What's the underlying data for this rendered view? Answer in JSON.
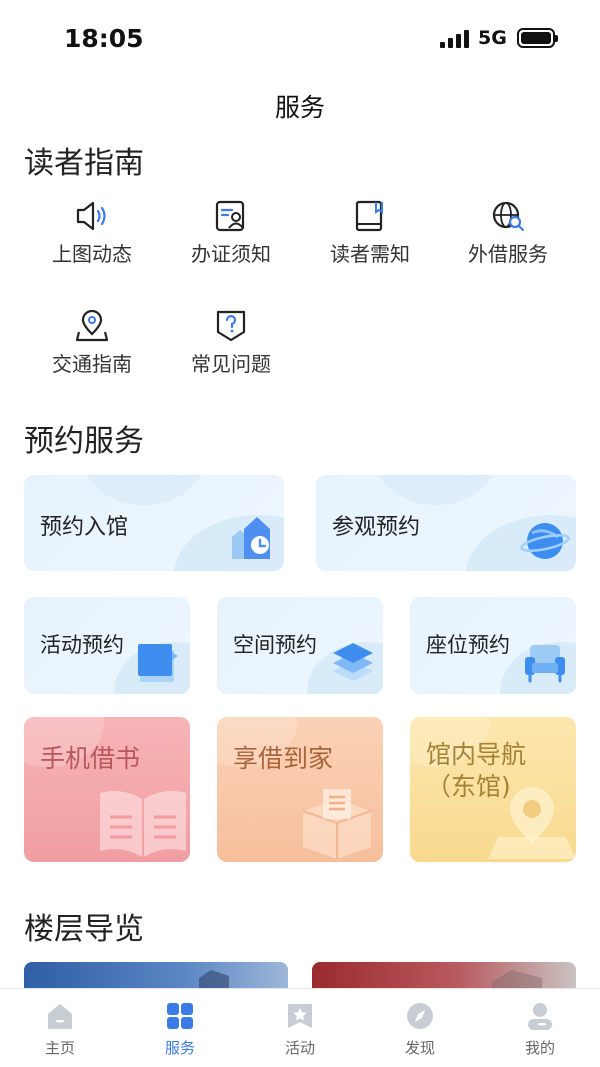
{
  "status_bar": {
    "time": "18:05",
    "network": "5G"
  },
  "page_title": "服务",
  "reader_guide": {
    "title": "读者指南",
    "items": [
      {
        "label": "上图动态",
        "icon": "speaker-icon"
      },
      {
        "label": "办证须知",
        "icon": "card-id-icon"
      },
      {
        "label": "读者需知",
        "icon": "book-bookmark-icon"
      },
      {
        "label": "外借服务",
        "icon": "globe-search-icon"
      },
      {
        "label": "交通指南",
        "icon": "location-pin-icon"
      },
      {
        "label": "常见问题",
        "icon": "question-shield-icon"
      }
    ]
  },
  "reservation": {
    "title": "预约服务",
    "cards": [
      {
        "label": "预约入馆",
        "icon": "house-clock-icon"
      },
      {
        "label": "参观预约",
        "icon": "planet-icon"
      },
      {
        "label": "活动预约",
        "icon": "blue-book-icon"
      },
      {
        "label": "空间预约",
        "icon": "layers-icon"
      },
      {
        "label": "座位预约",
        "icon": "armchair-icon"
      },
      {
        "label": "手机借书",
        "icon": "open-book-icon"
      },
      {
        "label": "享借到家",
        "icon": "parcel-box-icon"
      },
      {
        "label": "馆内导航\n（东馆)",
        "icon": "map-pin-icon"
      }
    ]
  },
  "floor_guide": {
    "title": "楼层导览"
  },
  "tab_bar": {
    "tabs": [
      {
        "label": "主页",
        "icon": "home-icon",
        "active": false
      },
      {
        "label": "服务",
        "icon": "grid-icon",
        "active": true
      },
      {
        "label": "活动",
        "icon": "star-bookmark-icon",
        "active": false
      },
      {
        "label": "发现",
        "icon": "compass-icon",
        "active": false
      },
      {
        "label": "我的",
        "icon": "user-icon",
        "active": false
      }
    ]
  },
  "colors": {
    "accent": "#3c7be7",
    "tab_inactive": "#c8ccd3"
  }
}
